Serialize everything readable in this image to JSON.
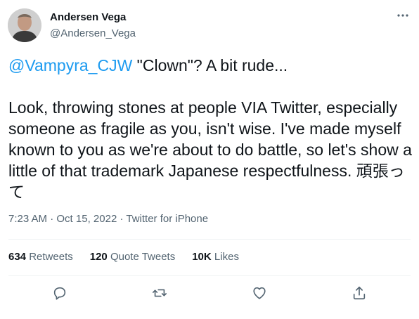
{
  "author": {
    "name": "Andersen Vega",
    "handle": "@Andersen_Vega"
  },
  "tweet": {
    "mention": "@Vampyra_CJW",
    "line1_rest": " \"Clown\"? A bit rude...",
    "body": "Look, throwing stones at people VIA Twitter, especially someone as fragile as you, isn't wise. I've made myself known to you as we're about to do battle, so let's show a little of that trademark Japanese respectfulness. 頑張って"
  },
  "meta": {
    "time": "7:23 AM",
    "separator1": " · ",
    "date": "Oct 15, 2022",
    "separator2": " · ",
    "source": "Twitter for iPhone"
  },
  "stats": {
    "retweets_count": "634",
    "retweets_label": "Retweets",
    "quotes_count": "120",
    "quotes_label": "Quote Tweets",
    "likes_count": "10K",
    "likes_label": "Likes"
  },
  "icons": {
    "reply": "reply-icon",
    "retweet": "retweet-icon",
    "like": "heart-icon",
    "share": "share-icon",
    "more": "more-icon"
  },
  "colors": {
    "accent": "#1d9bf0",
    "secondary_text": "#536471",
    "divider": "#eff3f4"
  }
}
